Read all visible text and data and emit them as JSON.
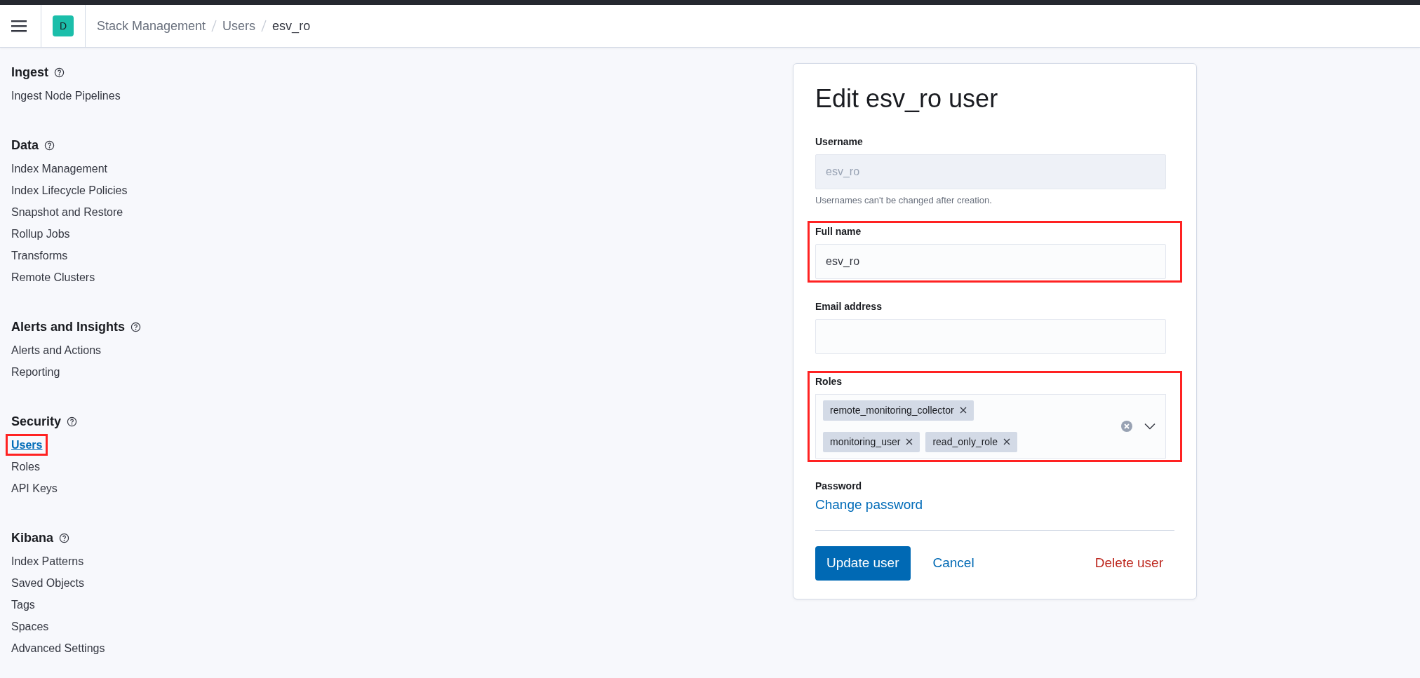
{
  "header": {
    "avatar": "D",
    "breadcrumbs": [
      {
        "label": "Stack Management",
        "current": false
      },
      {
        "label": "Users",
        "current": false
      },
      {
        "label": "esv_ro",
        "current": true
      }
    ]
  },
  "sidebar": {
    "sections": [
      {
        "title": "Ingest",
        "items": [
          {
            "label": "Ingest Node Pipelines",
            "selected": false,
            "highlighted": false
          }
        ]
      },
      {
        "title": "Data",
        "items": [
          {
            "label": "Index Management",
            "selected": false,
            "highlighted": false
          },
          {
            "label": "Index Lifecycle Policies",
            "selected": false,
            "highlighted": false
          },
          {
            "label": "Snapshot and Restore",
            "selected": false,
            "highlighted": false
          },
          {
            "label": "Rollup Jobs",
            "selected": false,
            "highlighted": false
          },
          {
            "label": "Transforms",
            "selected": false,
            "highlighted": false
          },
          {
            "label": "Remote Clusters",
            "selected": false,
            "highlighted": false
          }
        ]
      },
      {
        "title": "Alerts and Insights",
        "items": [
          {
            "label": "Alerts and Actions",
            "selected": false,
            "highlighted": false
          },
          {
            "label": "Reporting",
            "selected": false,
            "highlighted": false
          }
        ]
      },
      {
        "title": "Security",
        "items": [
          {
            "label": "Users",
            "selected": true,
            "highlighted": true
          },
          {
            "label": "Roles",
            "selected": false,
            "highlighted": false
          },
          {
            "label": "API Keys",
            "selected": false,
            "highlighted": false
          }
        ]
      },
      {
        "title": "Kibana",
        "items": [
          {
            "label": "Index Patterns",
            "selected": false,
            "highlighted": false
          },
          {
            "label": "Saved Objects",
            "selected": false,
            "highlighted": false
          },
          {
            "label": "Tags",
            "selected": false,
            "highlighted": false
          },
          {
            "label": "Spaces",
            "selected": false,
            "highlighted": false
          },
          {
            "label": "Advanced Settings",
            "selected": false,
            "highlighted": false
          }
        ]
      }
    ]
  },
  "form": {
    "title": "Edit esv_ro user",
    "fields": [
      {
        "kind": "text",
        "label": "Username",
        "value": "esv_ro",
        "disabled": true,
        "help": "Usernames can't be changed after creation.",
        "highlighted": false
      },
      {
        "kind": "text",
        "label": "Full name",
        "value": "esv_ro",
        "disabled": false,
        "highlighted": true
      },
      {
        "kind": "text",
        "label": "Email address",
        "disabled": false,
        "highlighted": false
      },
      {
        "kind": "combo",
        "label": "Roles",
        "roles": [
          "remote_monitoring_collector",
          "monitoring_user",
          "read_only_role"
        ],
        "highlighted": true
      },
      {
        "kind": "link",
        "label": "Password",
        "link": "Change password",
        "highlighted": false
      }
    ],
    "buttons": [
      {
        "label": "Update user",
        "kind": "primary"
      },
      {
        "label": "Cancel",
        "kind": "link"
      },
      {
        "label": "Delete user",
        "kind": "danger"
      }
    ]
  }
}
